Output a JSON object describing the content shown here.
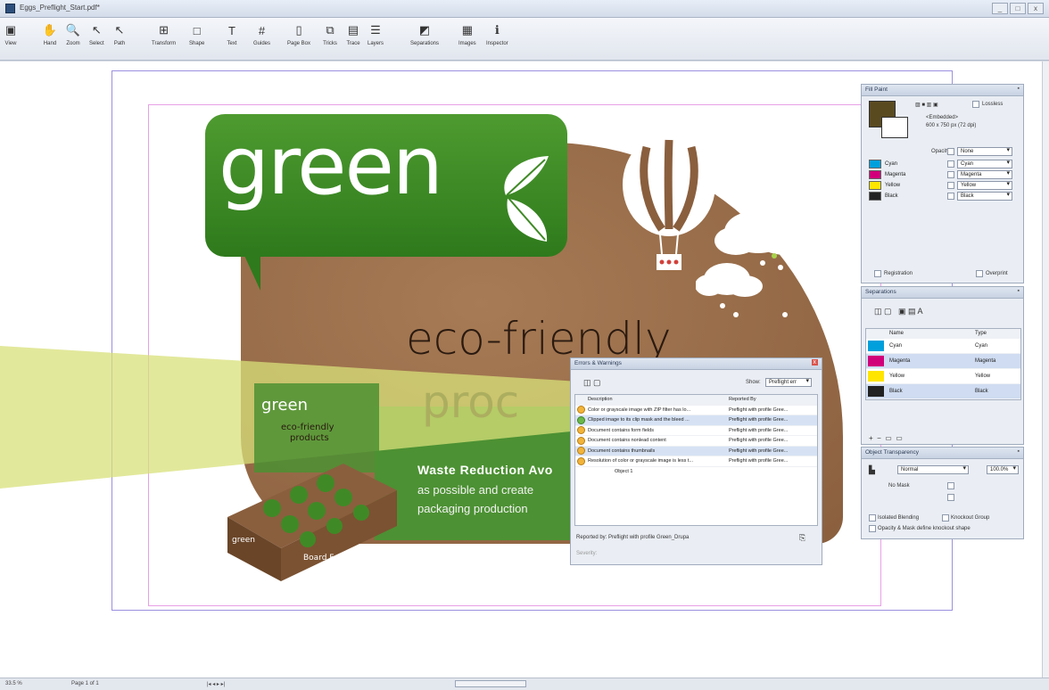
{
  "window": {
    "title": "Eggs_Preflight_Start.pdf*",
    "buttons": [
      "_",
      "□",
      "x"
    ]
  },
  "toolbar": {
    "tools": [
      {
        "label": "View",
        "icon": "view-icon",
        "glyph": "▣"
      },
      {
        "label": "Hand",
        "icon": "hand-icon",
        "glyph": "✋"
      },
      {
        "label": "Zoom",
        "icon": "zoom-icon",
        "glyph": "🔍"
      },
      {
        "label": "Select",
        "icon": "select-arrow-icon",
        "glyph": "↖"
      },
      {
        "label": "Path",
        "icon": "path-arrow-icon",
        "glyph": "↖"
      },
      {
        "label": "Transform",
        "icon": "transform-icon",
        "glyph": "⊞"
      },
      {
        "label": "Shape",
        "icon": "shape-icon",
        "glyph": "□"
      },
      {
        "label": "Text",
        "icon": "text-icon",
        "glyph": "T"
      },
      {
        "label": "Guides",
        "icon": "guides-icon",
        "glyph": "#"
      },
      {
        "label": "Page Box",
        "icon": "page-box-icon",
        "glyph": "▯"
      },
      {
        "label": "Tricks",
        "icon": "tricks-icon",
        "glyph": "⧉"
      },
      {
        "label": "Trace",
        "icon": "trace-icon",
        "glyph": "▤"
      },
      {
        "label": "Layers",
        "icon": "layers-icon",
        "glyph": "☰"
      },
      {
        "label": "Separations",
        "icon": "separations-icon",
        "glyph": "◩"
      },
      {
        "label": "Images",
        "icon": "images-icon",
        "glyph": "▦"
      },
      {
        "label": "Inspector",
        "icon": "inspector-icon",
        "glyph": "ℹ"
      }
    ]
  },
  "artwork": {
    "brand": "green",
    "headline_1": "eco-friendly",
    "headline_2": "proc",
    "body_title": "Waste Reduction Avo",
    "body_line_2": "as possible and create",
    "body_line_3": "packaging production",
    "box_brand": "green",
    "box_badge_1": "eco-friendly",
    "box_badge_2": "products",
    "box_footprint": "Board Footprint"
  },
  "fill_panel": {
    "title": "Fill Paint",
    "source": "<Embedded>",
    "dims": "600 x 750 px (72 dpi)",
    "lossless": "Lossless",
    "opacity_label": "Opacity",
    "opacity_value": "None",
    "inks": [
      {
        "name": "Cyan",
        "map": "Cyan",
        "color": "#00a0dc"
      },
      {
        "name": "Magenta",
        "map": "Magenta",
        "color": "#d1007a"
      },
      {
        "name": "Yellow",
        "map": "Yellow",
        "color": "#ffe500"
      },
      {
        "name": "Black",
        "map": "Black",
        "color": "#222222"
      }
    ],
    "registration": "Registration",
    "overprint": "Overprint"
  },
  "separations_panel": {
    "title": "Separations",
    "col_name": "Name",
    "col_type": "Type",
    "rows": [
      {
        "name": "Cyan",
        "type": "Cyan",
        "color": "#00a0dc"
      },
      {
        "name": "Magenta",
        "type": "Magenta",
        "color": "#d1007a"
      },
      {
        "name": "Yellow",
        "type": "Yellow",
        "color": "#ffe500"
      },
      {
        "name": "Black",
        "type": "Black",
        "color": "#222222"
      }
    ]
  },
  "transparency_panel": {
    "title": "Object Transparency",
    "mode": "Normal",
    "percent": "100.0%",
    "no_mask": "No Mask",
    "isolated": "Isolated Blending",
    "knockout": "Knockout Group",
    "opacity_mask_note": "Opacity & Mask define knockout shape"
  },
  "errors_dialog": {
    "title": "Errors & Warnings",
    "show_label": "Show:",
    "show_value": "Preflight err",
    "col_desc": "Description",
    "col_rep": "Reported By",
    "rows": [
      {
        "desc": "Color or grayscale image with ZIP filter has lo...",
        "rep": "Preflight with profile Gree...",
        "ok": false
      },
      {
        "desc": "Clipped image to its clip mask and the bleed ...",
        "rep": "Preflight with profile Gree...",
        "ok": true
      },
      {
        "desc": "Document contains form fields",
        "rep": "Preflight with profile Gree...",
        "ok": false
      },
      {
        "desc": "Document contains nonlead content",
        "rep": "Preflight with profile Gree...",
        "ok": false
      },
      {
        "desc": "Document contains thumbnails",
        "rep": "Preflight with profile Gree...",
        "ok": false
      },
      {
        "desc": "Resolution of color or grayscale image is less t...",
        "rep": "Preflight with profile Gree...",
        "ok": false
      }
    ],
    "sub_item": "Object 1",
    "reported_by": "Reported by: Preflight with profile Green_Drupa",
    "severity": "Severity:"
  },
  "status": {
    "zoom": "33.5 %",
    "page": "Page 1 of 1",
    "nav": "|◂ ◂ ▸ ▸| "
  }
}
